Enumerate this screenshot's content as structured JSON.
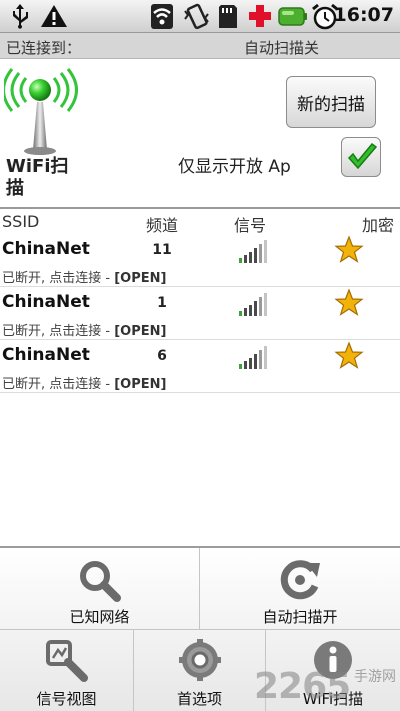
{
  "status_bar": {
    "time": "16:07",
    "icons": [
      "usb-icon",
      "warning-icon",
      "wifi-icon",
      "vibrate-icon",
      "sd-card-icon",
      "health-cross-icon",
      "battery-icon",
      "alarm-clock-icon"
    ]
  },
  "connection_bar": {
    "connected_label": "已连接到：",
    "auto_scan_status": "自动扫描关"
  },
  "header": {
    "logo_label": "WiFi扫描",
    "new_scan_button": "新的扫描",
    "open_only_label": "仅显示开放 Ap",
    "open_only_checked": true
  },
  "table": {
    "columns": [
      "SSID",
      "频道",
      "信号",
      "加密"
    ],
    "rows": [
      {
        "ssid": "ChinaNet",
        "channel": "11",
        "status_prefix": "已断开, 点击连接 - ",
        "security": "[OPEN]"
      },
      {
        "ssid": "ChinaNet",
        "channel": "1",
        "status_prefix": "已断开, 点击连接 - ",
        "security": "[OPEN]"
      },
      {
        "ssid": "ChinaNet",
        "channel": "6",
        "status_prefix": "已断开, 点击连接 - ",
        "security": "[OPEN]"
      }
    ]
  },
  "menu": {
    "known_networks": "已知网络",
    "auto_scan_on": "自动扫描开",
    "signal_view": "信号视图",
    "preferences": "首选项",
    "wifi_scan": "WiFi扫描"
  },
  "watermark": {
    "number": "2265",
    "text": "手游网"
  },
  "colors": {
    "accent_green": "#34c43c",
    "star": "#f2b20c",
    "menu_bg": "#efefef"
  }
}
